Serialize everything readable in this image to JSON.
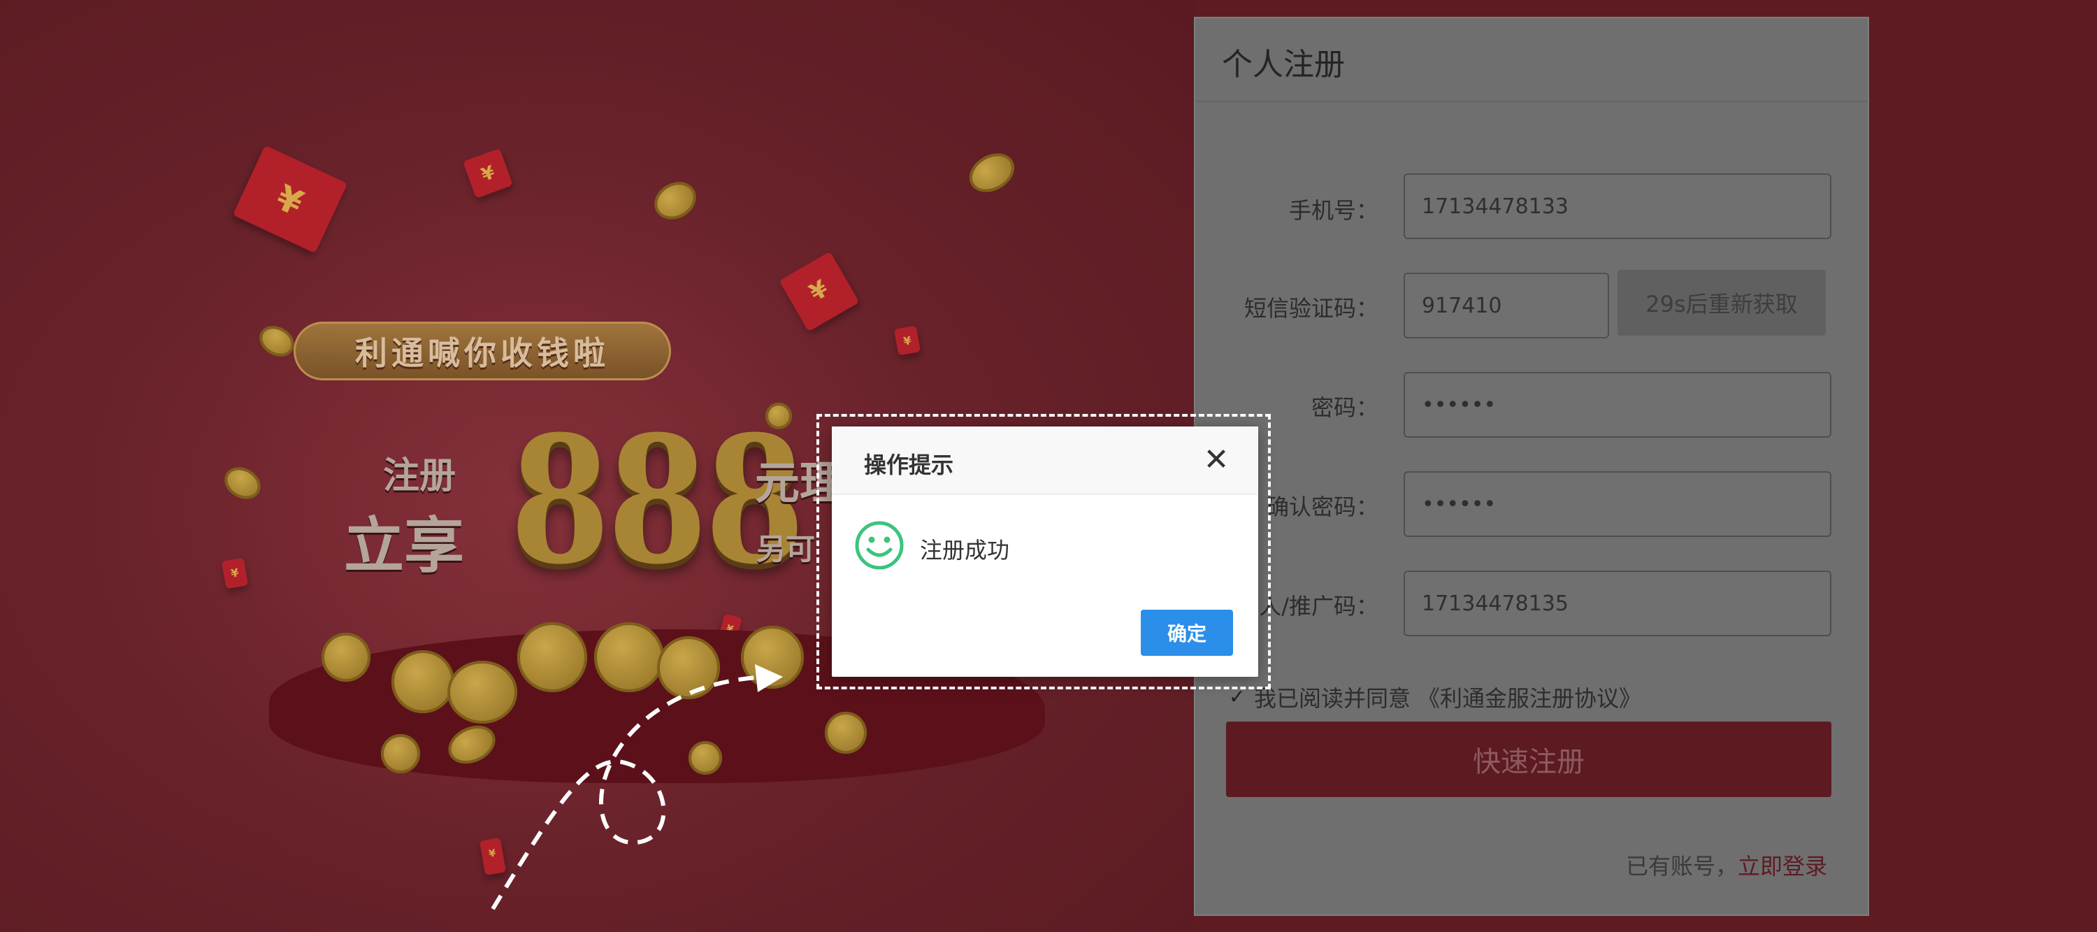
{
  "promo": {
    "banner_text": "利通喊你收钱啦",
    "line1": "注册",
    "line2": "立享",
    "amount": "888",
    "suffix_top": "元理",
    "suffix_bottom": "另可"
  },
  "register_panel": {
    "title": "个人注册",
    "phone_label": "手机号：",
    "phone_value": "17134478133",
    "sms_label": "短信验证码：",
    "sms_value": "917410",
    "resend_label": "29s后重新获取",
    "password_label": "密码：",
    "password_value": "••••••",
    "confirm_label": "确认密码：",
    "confirm_value": "••••••",
    "referrer_label": "人/推广码：",
    "referrer_value": "17134478135",
    "agree_text": "我已阅读并同意",
    "agreement_link": "《利通金服注册协议》",
    "submit_label": "快速注册",
    "has_account_text": "已有账号，",
    "login_link": "立即登录"
  },
  "dialog": {
    "title": "操作提示",
    "close_icon": "✕",
    "message": "注册成功",
    "ok_label": "确定",
    "icon": "smile-icon"
  },
  "colors": {
    "background_red": "#5e1b22",
    "dialog_button": "#2b8ee8",
    "smile_green": "#3cc47c"
  }
}
